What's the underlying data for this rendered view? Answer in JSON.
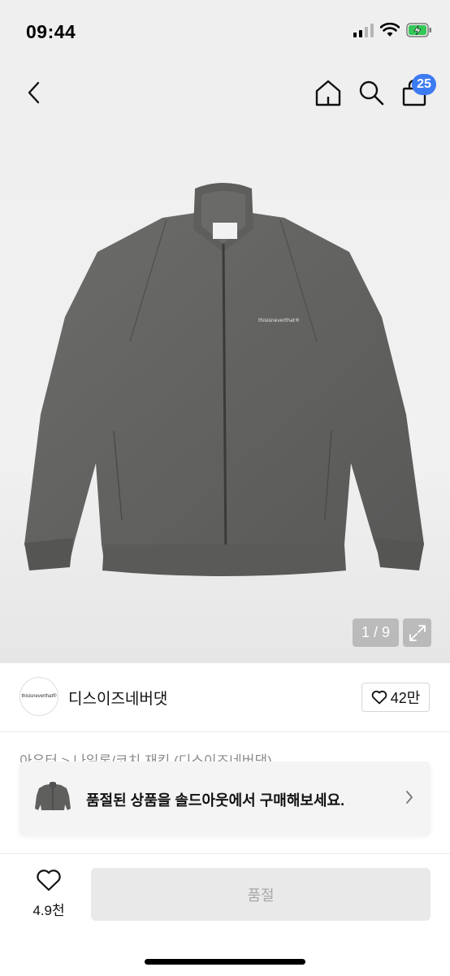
{
  "status_bar": {
    "time": "09:44"
  },
  "header": {
    "back_icon": "chevron-left-icon",
    "home_icon": "home-icon",
    "search_icon": "search-icon",
    "cart_icon": "shopping-bag-icon",
    "cart_count": "25",
    "badge_color": "#3d7bf2"
  },
  "gallery": {
    "counter": "1 / 9",
    "expand_icon": "expand-icon",
    "jacket_logo_text": "thisisneverthat®"
  },
  "brand": {
    "logo_text": "thisisneverthat®",
    "name": "디스이즈네버댓",
    "like_count": "42만"
  },
  "breadcrumb": "아우터 > 나일론/코치 재킷 (디스이즈네버댓)",
  "soldout_banner": {
    "text": "품절된 상품을 솔드아웃에서 구매해보세요."
  },
  "bottom_bar": {
    "wish_count": "4.9천",
    "buy_label": "품절"
  }
}
